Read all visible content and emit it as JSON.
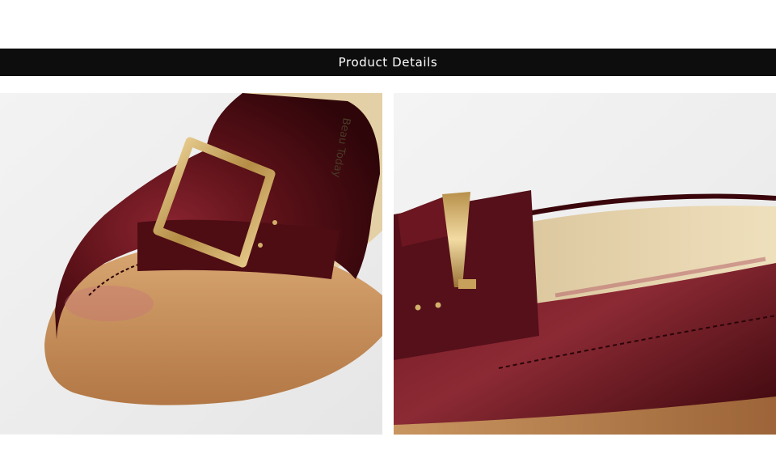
{
  "header": {
    "title": "Product Details"
  },
  "photos": [
    {
      "name": "shoe-toe-buckle-closeup",
      "insole_brand_text": "Beau Today"
    },
    {
      "name": "shoe-side-buckle-closeup"
    }
  ],
  "colors": {
    "header_bar": "#0d0d0d",
    "header_text": "#ffffff",
    "leather": "#5a0f16",
    "buckle": "#c9a45c",
    "insole": "#e2cfa4",
    "sole": "#c8945a"
  }
}
